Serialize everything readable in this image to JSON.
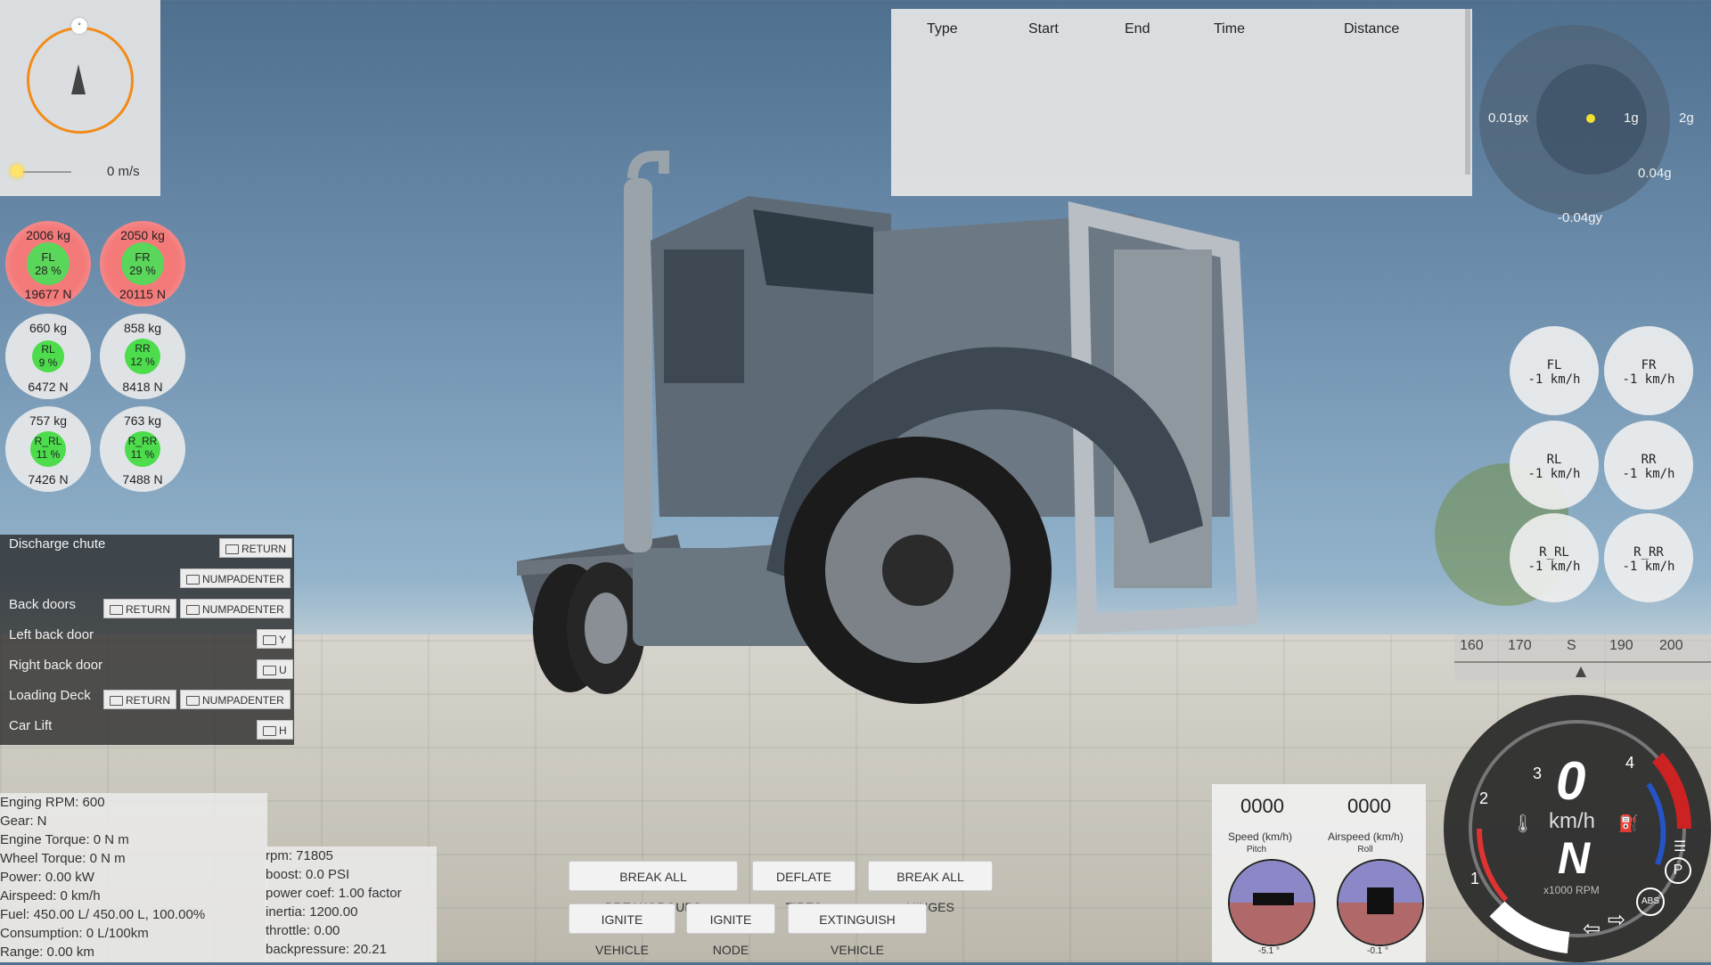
{
  "compass": {
    "knob_label": "°",
    "speed": "0 m/s"
  },
  "wheel_loads": [
    {
      "id": "fl",
      "mass": "2006 kg",
      "name": "FL",
      "percent": "28 %",
      "force": "19677 N",
      "color": "red"
    },
    {
      "id": "fr",
      "mass": "2050 kg",
      "name": "FR",
      "percent": "29 %",
      "force": "20115 N",
      "color": "red"
    },
    {
      "id": "rl",
      "mass": "660 kg",
      "name": "RL",
      "percent": "9 %",
      "force": "6472 N",
      "color": "normal"
    },
    {
      "id": "rr",
      "mass": "858 kg",
      "name": "RR",
      "percent": "12 %",
      "force": "8418 N",
      "color": "normal"
    },
    {
      "id": "r_rl",
      "mass": "757 kg",
      "name": "R_RL",
      "percent": "11 %",
      "force": "7426 N",
      "color": "normal"
    },
    {
      "id": "r_rr",
      "mass": "763 kg",
      "name": "R_RR",
      "percent": "11 %",
      "force": "7488 N",
      "color": "normal"
    }
  ],
  "actions": {
    "discharge_chute": "Discharge chute",
    "back_doors": "Back doors",
    "left_back_door": "Left back door",
    "right_back_door": "Right back door",
    "loading_deck": "Loading Deck",
    "car_lift": "Car Lift",
    "keys": {
      "return": "RETURN",
      "numpadenter": "NUMPADENTER",
      "y": "Y",
      "u": "U",
      "h": "H"
    }
  },
  "engine_info": [
    "Enging RPM: 600",
    "Gear: N",
    "Engine Torque: 0 N m",
    "Wheel Torque: 0 N m",
    "Power: 0.00 kW",
    "Airspeed: 0 km/h",
    "Fuel: 450.00 L/ 450.00 L, 100.00%",
    "Consumption: 0 L/100km",
    "Range: 0.00 km"
  ],
  "turbo_info": [
    "rpm: 71805",
    "boost: 0.0 PSI",
    "power coef: 1.00 factor",
    "inertia: 1200.00",
    "throttle: 0.00",
    "backpressure: 20.21"
  ],
  "buttons": {
    "break_breakgroups": "BREAK ALL BREAKGROUPS",
    "deflate_tires": "DEFLATE TIRES",
    "break_hinges": "BREAK ALL HINGES",
    "ignite_vehicle": "IGNITE VEHICLE",
    "ignite_node": "IGNITE NODE",
    "extinguish_vehicle": "EXTINGUISH VEHICLE"
  },
  "timing_table": {
    "columns": [
      "Type",
      "Start",
      "End",
      "Time",
      "Distance"
    ]
  },
  "gforce": {
    "x_left": "0.01gx",
    "ring_1g": "1g",
    "ring_2g": "2g",
    "y_top": "0.04g",
    "y_bottom": "-0.04gy"
  },
  "wheel_speeds": [
    {
      "id": "fl",
      "name": "FL",
      "value": "-1 km/h"
    },
    {
      "id": "fr",
      "name": "FR",
      "value": "-1 km/h"
    },
    {
      "id": "rl",
      "name": "RL",
      "value": "-1 km/h"
    },
    {
      "id": "rr",
      "name": "RR",
      "value": "-1 km/h"
    },
    {
      "id": "r_rl",
      "name": "R_RL",
      "value": "-1 km/h"
    },
    {
      "id": "r_rr",
      "name": "R_RR",
      "value": "-1 km/h"
    }
  ],
  "heading": {
    "ticks": [
      "160",
      "170",
      "S",
      "190",
      "200"
    ]
  },
  "gauges": {
    "speed_value": "0000",
    "speed_label": "Speed (km/h)",
    "pitch_label": "Pitch",
    "pitch_value": "-5.1 °",
    "airspeed_value": "0000",
    "airspeed_label": "Airspeed (km/h)",
    "roll_label": "Roll",
    "roll_value": "-0.1 °"
  },
  "speedometer": {
    "speed": "0",
    "unit": "km/h",
    "gear": "N",
    "rpm_label": "x1000 RPM",
    "rpm_ticks": [
      "1",
      "2",
      "3",
      "4"
    ],
    "abs": "ABS",
    "parking": "P"
  },
  "colors": {
    "compass_ring": "#f28b18",
    "load_normal": "#4cdc4c",
    "load_high": "#f47a7a"
  }
}
